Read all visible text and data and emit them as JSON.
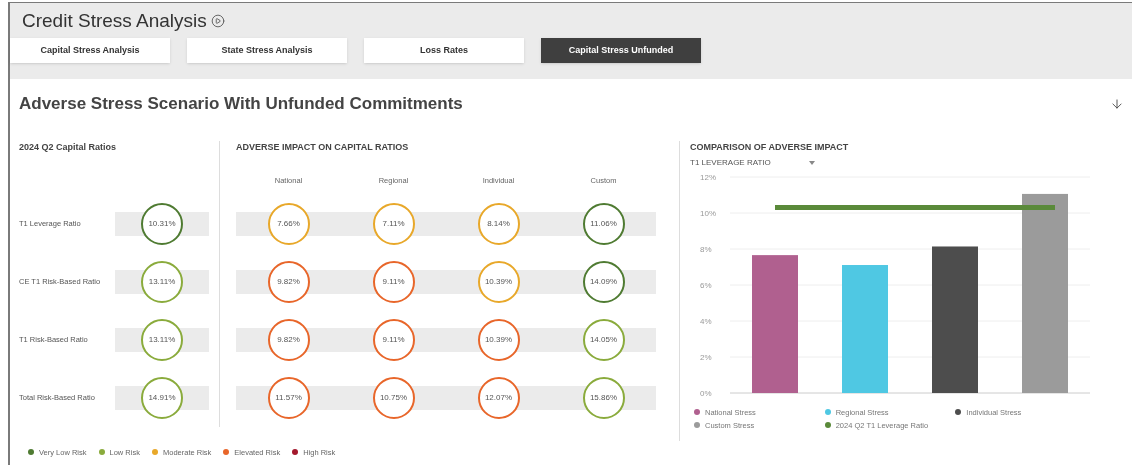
{
  "page": {
    "title": "Credit Stress Analysis"
  },
  "tabs": [
    {
      "label": "Capital Stress Analysis",
      "selected": false
    },
    {
      "label": "State Stress Analysis",
      "selected": false
    },
    {
      "label": "Loss Rates",
      "selected": false
    },
    {
      "label": "Capital Stress Unfunded",
      "selected": true
    }
  ],
  "panel": {
    "title": "Adverse Stress Scenario With Unfunded Commitments"
  },
  "capital_ratios": {
    "title": "2024 Q2 Capital Ratios",
    "rows": [
      {
        "label": "T1 Leverage Ratio",
        "value": "10.31%",
        "color": "#4f7b32"
      },
      {
        "label": "CE T1 Risk-Based Ratio",
        "value": "13.11%",
        "color": "#8aab3c"
      },
      {
        "label": "T1 Risk-Based Ratio",
        "value": "13.11%",
        "color": "#8aab3c"
      },
      {
        "label": "Total Risk-Based Ratio",
        "value": "14.91%",
        "color": "#8aab3c"
      }
    ]
  },
  "adverse_impact": {
    "title": "ADVERSE IMPACT ON CAPITAL RATIOS",
    "columns": [
      "National",
      "Regional",
      "Individual",
      "Custom"
    ],
    "rows": [
      {
        "cells": [
          {
            "value": "7.66%",
            "color": "#e8a82a"
          },
          {
            "value": "7.11%",
            "color": "#e8a82a"
          },
          {
            "value": "8.14%",
            "color": "#e8a82a"
          },
          {
            "value": "11.06%",
            "color": "#4f7b32"
          }
        ]
      },
      {
        "cells": [
          {
            "value": "9.82%",
            "color": "#e8662a"
          },
          {
            "value": "9.11%",
            "color": "#e8662a"
          },
          {
            "value": "10.39%",
            "color": "#e8a82a"
          },
          {
            "value": "14.09%",
            "color": "#4f7b32"
          }
        ]
      },
      {
        "cells": [
          {
            "value": "9.82%",
            "color": "#e8662a"
          },
          {
            "value": "9.11%",
            "color": "#e8662a"
          },
          {
            "value": "10.39%",
            "color": "#e8662a"
          },
          {
            "value": "14.05%",
            "color": "#8aab3c"
          }
        ]
      },
      {
        "cells": [
          {
            "value": "11.57%",
            "color": "#e8662a"
          },
          {
            "value": "10.75%",
            "color": "#e8662a"
          },
          {
            "value": "12.07%",
            "color": "#e8662a"
          },
          {
            "value": "15.86%",
            "color": "#8aab3c"
          }
        ]
      }
    ]
  },
  "risk_legend": [
    {
      "label": "Very Low Risk",
      "color": "#4f7b32"
    },
    {
      "label": "Low Risk",
      "color": "#8aab3c"
    },
    {
      "label": "Moderate Risk",
      "color": "#e8a82a"
    },
    {
      "label": "Elevated Risk",
      "color": "#e8662a"
    },
    {
      "label": "High Risk",
      "color": "#a3182c"
    }
  ],
  "comparison": {
    "title": "COMPARISON OF ADVERSE IMPACT",
    "dropdown": {
      "value": "T1 LEVERAGE RATIO"
    },
    "chart_data": {
      "type": "bar",
      "ylim": [
        0,
        12
      ],
      "grid": true,
      "legend": true,
      "yticks": [
        {
          "value": 0,
          "label": "0%"
        },
        {
          "value": 2,
          "label": "2%"
        },
        {
          "value": 4,
          "label": "4%"
        },
        {
          "value": 6,
          "label": "6%"
        },
        {
          "value": 8,
          "label": "8%"
        },
        {
          "value": 10,
          "label": "10%"
        },
        {
          "value": 12,
          "label": "12%"
        }
      ],
      "series": [
        {
          "name": "National Stress",
          "color": "#b0608f",
          "values": [
            7.66
          ]
        },
        {
          "name": "Regional Stress",
          "color": "#4fc8e3",
          "values": [
            7.11
          ]
        },
        {
          "name": "Individual Stress",
          "color": "#4d4d4d",
          "values": [
            8.14
          ]
        },
        {
          "name": "Custom Stress",
          "color": "#9b9b9b",
          "values": [
            11.06
          ]
        }
      ],
      "ref_lines": [
        {
          "axis": "y",
          "value": 10.31,
          "label": "2024 Q2 T1 Leverage Ratio",
          "color": "#5a8a3a"
        }
      ]
    }
  }
}
